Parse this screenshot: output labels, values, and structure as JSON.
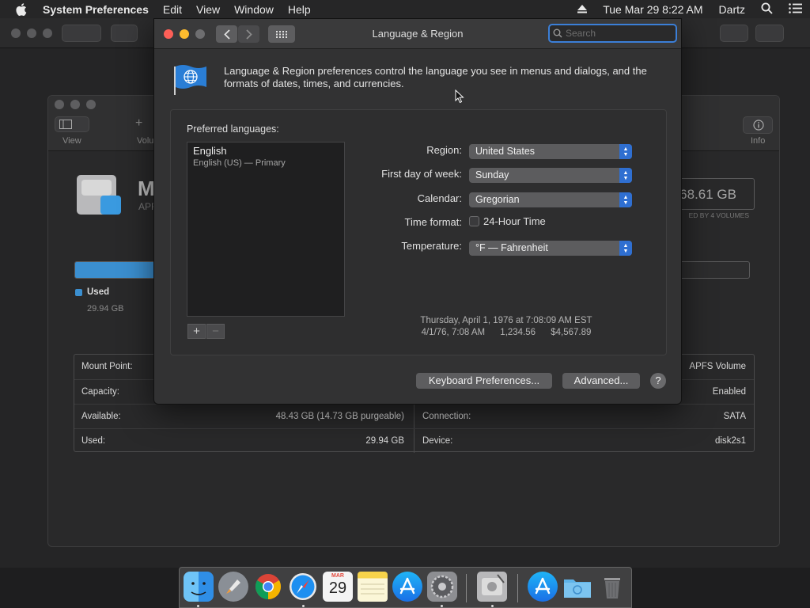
{
  "menubar": {
    "app_name": "System Preferences",
    "menus": [
      "Edit",
      "View",
      "Window",
      "Help"
    ],
    "datetime": "Tue Mar 29  8:22 AM",
    "user": "Dartz"
  },
  "window": {
    "title": "Language & Region",
    "search_placeholder": "Search",
    "description": "Language & Region preferences control the language you see in menus and dialogs, and the formats of dates, times, and currencies."
  },
  "languages": {
    "label": "Preferred languages:",
    "items": [
      {
        "name": "English",
        "detail": "English (US) — Primary"
      }
    ],
    "add_label": "+",
    "remove_label": "−"
  },
  "settings": {
    "region_label": "Region:",
    "region_value": "United States",
    "first_day_label": "First day of week:",
    "first_day_value": "Sunday",
    "calendar_label": "Calendar:",
    "calendar_value": "Gregorian",
    "time_format_label": "Time format:",
    "time_format_option": "24-Hour Time",
    "time_format_checked": false,
    "temperature_label": "Temperature:",
    "temperature_value": "°F — Fahrenheit"
  },
  "sample": {
    "line1": "Thursday, April 1, 1976 at 7:08:09 AM EST",
    "line2": "4/1/76, 7:08 AM      1,234.56      $4,567.89"
  },
  "buttons": {
    "keyboard": "Keyboard Preferences...",
    "advanced": "Advanced...",
    "help": "?"
  },
  "background_window": {
    "toolbar": {
      "view": "View",
      "volume": "Volu",
      "info": "Info"
    },
    "disk_title": "M",
    "disk_sub": "APF",
    "size": "68.61 GB",
    "shared": "ED BY 4 VOLUMES",
    "used_legend": "Used",
    "used_legend_value": "29.94 GB",
    "rows": [
      {
        "label": "Mount Point:",
        "value": "",
        "label2": "",
        "value2": "APFS Volume"
      },
      {
        "label": "Capacity:",
        "value": "",
        "label2": "",
        "value2": "Enabled"
      },
      {
        "label": "Available:",
        "value": "48.43 GB (14.73 GB purgeable)",
        "label2": "Connection:",
        "value2": "SATA"
      },
      {
        "label": "Used:",
        "value": "29.94 GB",
        "label2": "Device:",
        "value2": "disk2s1"
      }
    ]
  },
  "dock": {
    "calendar_month": "MAR",
    "calendar_day": "29"
  },
  "colors": {
    "accent": "#2f6fd1",
    "close": "#fd5f57",
    "minimize": "#febc2e",
    "used_bar": "#3b8fd0"
  },
  "icons": [
    "apple-icon",
    "eject-icon",
    "search-icon",
    "menu-list-icon",
    "globe-flag-icon",
    "hard-disk-icon",
    "finder-icon",
    "launchpad-icon",
    "chrome-icon",
    "safari-icon",
    "calendar-icon",
    "notes-icon",
    "app-store-icon",
    "system-preferences-icon",
    "disk-utility-icon",
    "downloads-folder-icon",
    "trash-icon"
  ]
}
